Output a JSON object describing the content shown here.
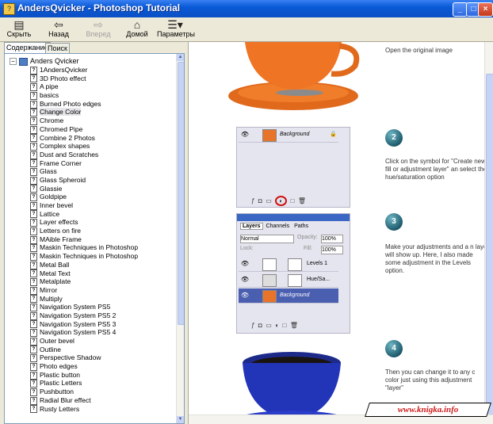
{
  "window": {
    "title": "AndersQvicker - Photoshop Tutorial"
  },
  "toolbar": {
    "hide": "Скрыть",
    "back": "Назад",
    "forward": "Вперед",
    "home": "Домой",
    "options": "Параметры"
  },
  "tabs": {
    "contents": "Содержание",
    "search": "Поиск"
  },
  "tree": {
    "root": "Anders Qvicker",
    "selected_index": 5,
    "items": [
      "1AndersQvicker",
      "3D Photo effect",
      "A pipe",
      "basics",
      "Burned Photo edges",
      "Change Color",
      "Chrome",
      "Chromed Pipe",
      "Combine 2 Photos",
      "Complex shapes",
      "Dust and Scratches",
      "Frame Corner",
      "Glass",
      "Glass Spheroid",
      "Glassie",
      "Goldpipe",
      "Inner bevel",
      "Lattice",
      "Layer effects",
      "Letters on fire",
      "MAible Frame",
      "Maskin Techniques in Photoshop",
      "Maskin Techniques in Photoshop",
      "Metal Ball",
      "Metal Text",
      "Metalplate",
      "Mirror",
      "Multiply",
      "Navigation System PS5",
      "Navigation System PS5 2",
      "Navigation System PS5 3",
      "Navigation System PS5 4",
      "Outer bevel",
      "Outline",
      "Perspective Shadow",
      "Photo edges",
      "Plastic button",
      "Plastic Letters",
      "Pushbutton",
      "Radial Blur effect",
      "Rusty Letters"
    ]
  },
  "steps": [
    {
      "num": "",
      "text": "Open the original image"
    },
    {
      "num": "2",
      "text": "Click on the symbol for \"Create new fill or adjustment layer\" an select the hue/saturation option"
    },
    {
      "num": "3",
      "text": "Make your adjustments and a n layer will show up. Here, I also made some adjustment in the Levels option."
    },
    {
      "num": "4",
      "text": "Then you can change it to any c color just using this adjustment \"layer\""
    }
  ],
  "panel1": {
    "layer": "Background"
  },
  "panel2": {
    "tabs": [
      "Layers",
      "Channels",
      "Paths"
    ],
    "blend_mode": "Normal",
    "opacity_label": "Opacity:",
    "opacity": "100%",
    "lock_label": "Lock:",
    "fill_label": "Fill:",
    "fill": "100%",
    "layers": [
      "Levels 1",
      "Hue/Sa...",
      "Background"
    ]
  },
  "watermark": "www.knigka.info",
  "colors": {
    "titlebar": "#0a5ad7",
    "selection": "#4a5fb0",
    "watermark": "#d01a1a"
  }
}
